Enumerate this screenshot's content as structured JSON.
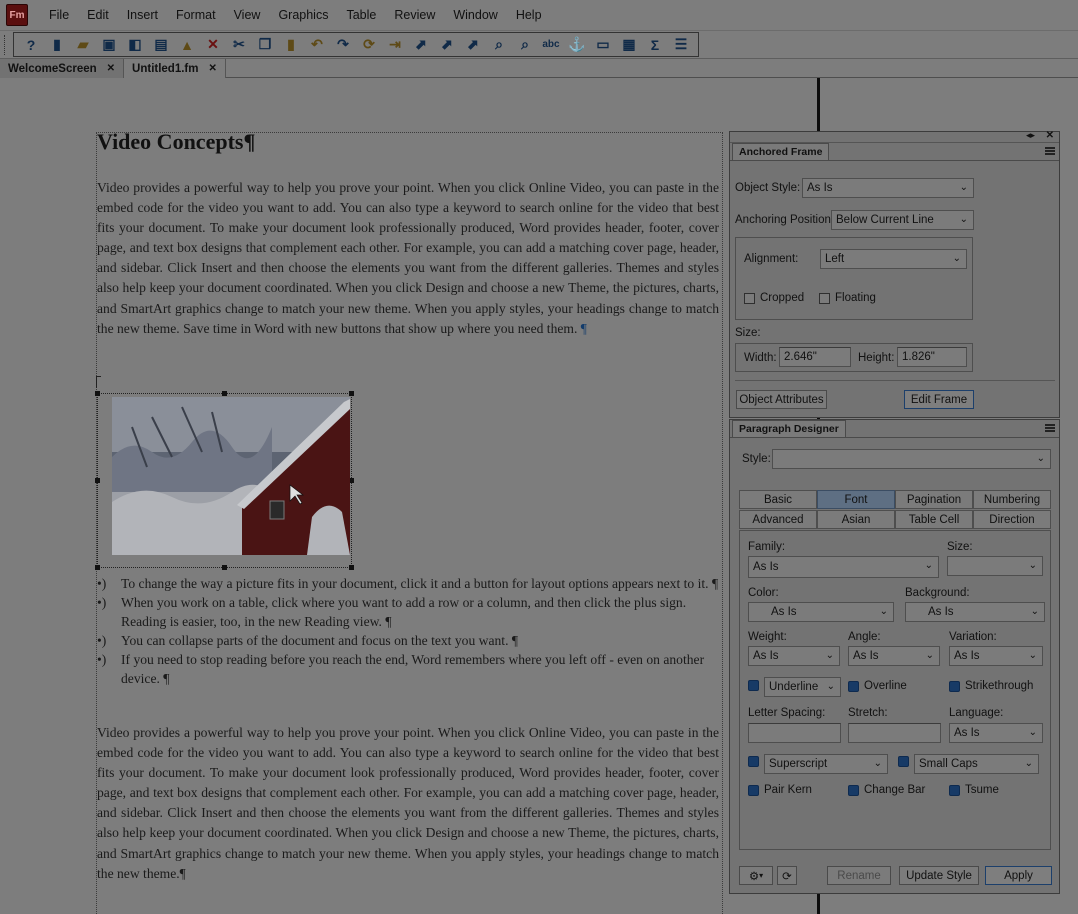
{
  "app": {
    "logo": "Fm"
  },
  "menu": [
    "File",
    "Edit",
    "Insert",
    "Format",
    "View",
    "Graphics",
    "Table",
    "Review",
    "Window",
    "Help"
  ],
  "toolbar": {
    "icons": [
      "help-icon",
      "new-icon",
      "open-icon",
      "save-icon",
      "save-as-icon",
      "print-icon",
      "lock-icon",
      "delete-icon",
      "cut-icon",
      "copy-icon",
      "paste-icon",
      "undo-icon",
      "redo-icon",
      "repeat-icon",
      "import-icon",
      "anchored-frame-icon",
      "insert-frame-icon",
      "hyperlink-icon",
      "find-icon",
      "zoom-icon",
      "spellcheck-icon",
      "anchor-icon",
      "page-icon",
      "table-icon",
      "equation-icon",
      "paragraph-designer-icon"
    ]
  },
  "tabs": [
    {
      "label": "WelcomeScreen",
      "active": false
    },
    {
      "label": "Untitled1.fm",
      "active": true
    }
  ],
  "document": {
    "title": "Video Concepts¶",
    "paragraph1": "Video provides a powerful way to help you prove your point. When you click Online Video, you can paste in the embed code for the video you want to add. You can also type a keyword to search online for the video that best fits your document. To make your document look professionally produced, Word provides header, footer, cover page, and text box designs that complement each other. For example, you can add a matching cover page, header, and sidebar. Click Insert and then choose the elements you want from the different galleries. Themes and styles also help keep your document coordinated. When you click Design and choose a new Theme, the pictures, charts, and SmartArt graphics change to match your new theme. When you apply styles, your headings change to match the new theme. Save time in Word with new buttons that show up where you need them.",
    "pilcrow": "¶",
    "bullet_marker": "•)",
    "bullets": [
      "To change the way a picture fits in your document, click it and a button for layout options appears next to it. ¶",
      "When you work on a table, click where you want to add a row or a column, and then click the plus sign. Reading is easier, too, in the new Reading view. ¶",
      "You can collapse parts of the document and focus on the text you want. ¶",
      "If you need to stop reading before you reach the end, Word remembers where you left off - even on another device. ¶"
    ],
    "paragraph2": "Video provides a powerful way to help you prove your point. When you click Online Video, you can paste in the embed code for the video you want to add. You can also type a keyword to search online for the video that best fits your document. To make your document look professionally produced, Word provides header, footer, cover page, and text box designs that complement each other. For example, you can add a matching cover page, header, and sidebar. Click Insert and then choose the elements you want from the different galleries. Themes and styles also help keep your document coordinated. When you click Design and choose a new Theme, the pictures, charts, and SmartArt graphics change to match your new theme. When you apply styles, your headings change to match the new theme.¶"
  },
  "anchored_frame": {
    "tab": "Anchored Frame",
    "object_style_label": "Object Style:",
    "object_style_value": "As Is",
    "anchoring_label": "Anchoring Position:",
    "anchoring_value": "Below Current Line",
    "alignment_label": "Alignment:",
    "alignment_value": "Left",
    "cropped_label": "Cropped",
    "floating_label": "Floating",
    "size_label": "Size:",
    "width_label": "Width:",
    "width_value": "2.646\"",
    "height_label": "Height:",
    "height_value": "1.826\"",
    "object_attributes_button": "Object Attributes",
    "edit_frame_button": "Edit Frame"
  },
  "paragraph_designer": {
    "tab": "Paragraph Designer",
    "style_label": "Style:",
    "style_value": "",
    "tabs_row1": [
      "Basic",
      "Font",
      "Pagination",
      "Numbering"
    ],
    "tabs_row2": [
      "Advanced",
      "Asian",
      "Table Cell",
      "Direction"
    ],
    "active_tab": "Font",
    "family_label": "Family:",
    "family_value": "As Is",
    "size_label": "Size:",
    "size_value": "",
    "color_label": "Color:",
    "color_value": "As Is",
    "background_label": "Background:",
    "background_value": "As Is",
    "weight_label": "Weight:",
    "weight_value": "As Is",
    "angle_label": "Angle:",
    "angle_value": "As Is",
    "variation_label": "Variation:",
    "variation_value": "As Is",
    "underline_value": "Underline",
    "overline_label": "Overline",
    "strikethrough_label": "Strikethrough",
    "letter_spacing_label": "Letter Spacing:",
    "letter_spacing_value": "",
    "stretch_label": "Stretch:",
    "stretch_value": "",
    "language_label": "Language:",
    "language_value": "As Is",
    "superscript_value": "Superscript",
    "small_caps_value": "Small Caps",
    "pair_kern_label": "Pair Kern",
    "change_bar_label": "Change Bar",
    "tsume_label": "Tsume",
    "rename_button": "Rename",
    "update_style_button": "Update Style",
    "apply_button": "Apply"
  }
}
